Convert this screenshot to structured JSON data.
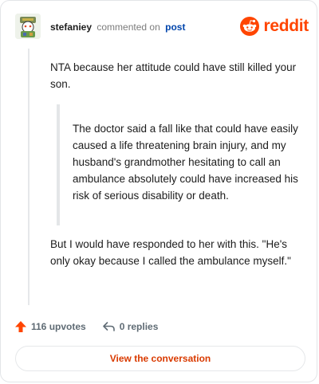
{
  "header": {
    "username": "stefaniey",
    "action_text": "commented on",
    "post_link": "post",
    "brand": "reddit"
  },
  "comment": {
    "paragraph_1": "NTA because her attitude could have still killed your son.",
    "quote": "The doctor said a fall like that could have easily caused a life threatening brain injury, and my husband's grandmother hesitating to call an ambulance absolutely could have increased his risk of serious disability or death.",
    "paragraph_2": "But I would have responded to her with this. \"He's only okay because I called the ambulance myself.\""
  },
  "actions": {
    "upvotes": "116 upvotes",
    "replies": "0 replies"
  },
  "cta_label": "View the conversation",
  "colors": {
    "brand": "#ff4500",
    "link": "#0045ac",
    "cta": "#d93a00",
    "muted": "#7c7c7c"
  },
  "icons": {
    "avatar": "snoo-avatar",
    "brand": "reddit-snoo-icon",
    "upvote": "upvote-arrow-icon",
    "reply": "reply-arrow-icon"
  }
}
